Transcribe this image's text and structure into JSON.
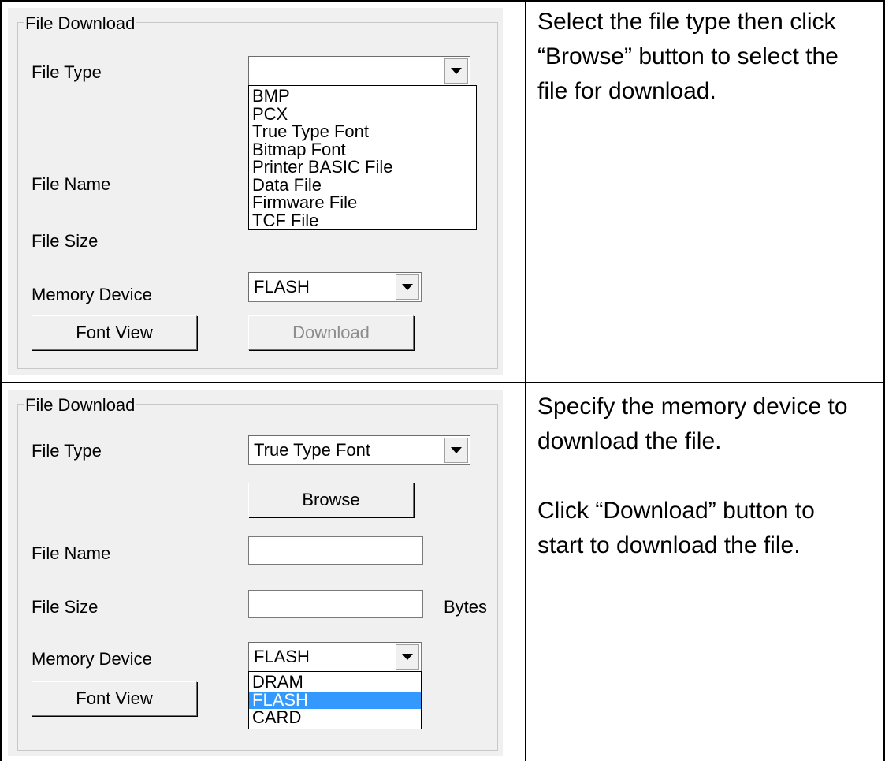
{
  "top_panel": {
    "group_title": "File Download",
    "file_type_label": "File Type",
    "file_type_value": "",
    "file_type_options": [
      "BMP",
      "PCX",
      "True Type Font",
      "Bitmap Font",
      "Printer BASIC File",
      "Data File",
      "Firmware File",
      "TCF File"
    ],
    "file_name_label": "File Name",
    "file_size_label": "File Size",
    "memory_device_label": "Memory Device",
    "memory_device_value": "FLASH",
    "font_view_label": "Font View",
    "download_label": "Download"
  },
  "bottom_panel": {
    "group_title": "File Download",
    "file_type_label": "File Type",
    "file_type_value": "True Type Font",
    "browse_label": "Browse",
    "file_name_label": "File Name",
    "file_size_label": "File Size",
    "bytes_label": "Bytes",
    "memory_device_label": "Memory Device",
    "memory_device_value": "FLASH",
    "memory_device_options": [
      "DRAM",
      "FLASH",
      "CARD"
    ],
    "memory_device_selected": "FLASH",
    "font_view_label": "Font View"
  },
  "descriptions": {
    "top": [
      "Select the file type then click",
      "“Browse” button to select the",
      "file for download."
    ],
    "bottom_1": [
      "Specify the memory device to",
      "download the file."
    ],
    "bottom_2": [
      "Click “Download” button to",
      "start to download the file."
    ]
  }
}
